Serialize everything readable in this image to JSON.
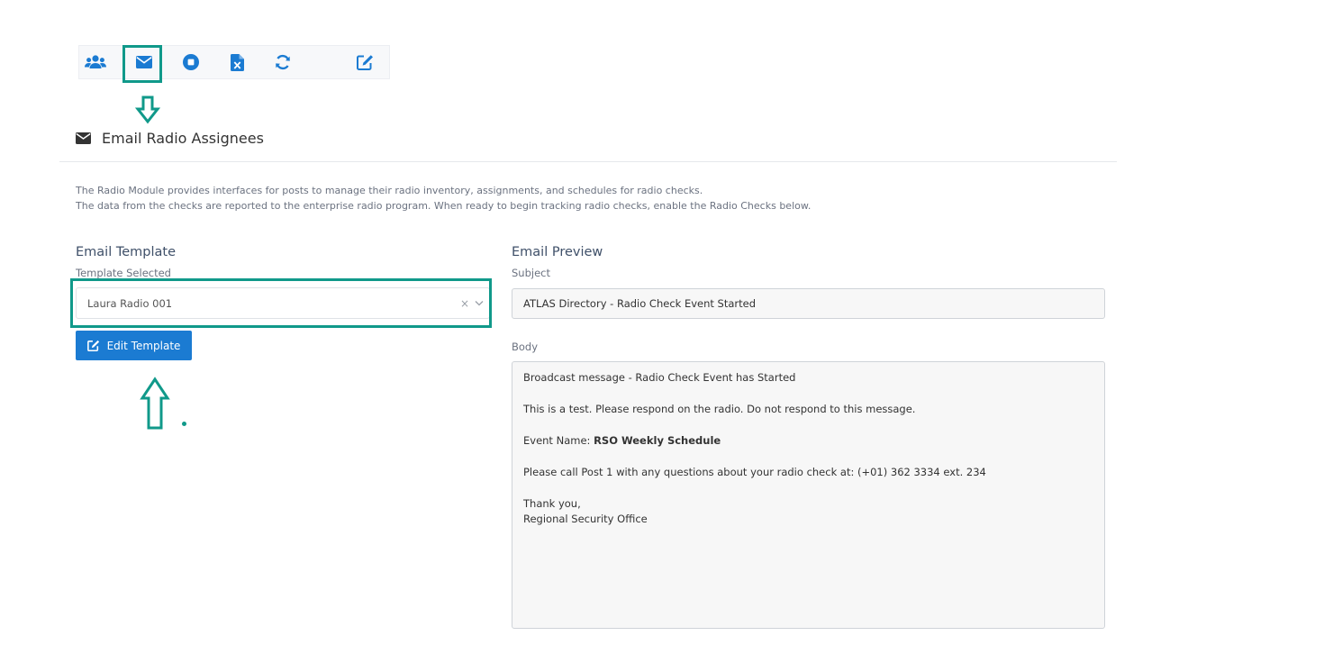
{
  "toolbar": {
    "buttons": [
      {
        "icon": "users-icon"
      },
      {
        "icon": "envelope-icon",
        "active": true
      },
      {
        "icon": "stop-circle-icon"
      },
      {
        "icon": "excel-file-icon"
      },
      {
        "icon": "refresh-icon"
      },
      {
        "icon": "edit-icon"
      }
    ]
  },
  "section": {
    "title": "Email Radio Assignees",
    "intro_line1": "The Radio Module provides interfaces for posts to manage their radio inventory, assignments, and schedules for radio checks.",
    "intro_line2": "The data from the checks are reported to the enterprise radio program. When ready to begin tracking radio checks, enable the Radio Checks below."
  },
  "template": {
    "heading": "Email Template",
    "select_label": "Template Selected",
    "selected_value": "Laura Radio 001",
    "clear_glyph": "×",
    "edit_button_label": "Edit Template"
  },
  "preview": {
    "heading": "Email Preview",
    "subject_label": "Subject",
    "subject_value": "ATLAS Directory - Radio Check Event Started",
    "body_label": "Body",
    "body": {
      "line1": "Broadcast message - Radio Check Event has Started",
      "line2": "This is a test. Please respond on the radio. Do not respond to this message.",
      "event_prefix": "Event Name: ",
      "event_name": "RSO Weekly Schedule",
      "line4": "Please call Post 1 with any questions about your radio check at: (+01) 362 3334 ext. 234",
      "signoff1": "Thank you,",
      "signoff2": "Regional Security Office"
    }
  },
  "colors": {
    "accent": "#1b7bd2",
    "annotation": "#10998a"
  }
}
